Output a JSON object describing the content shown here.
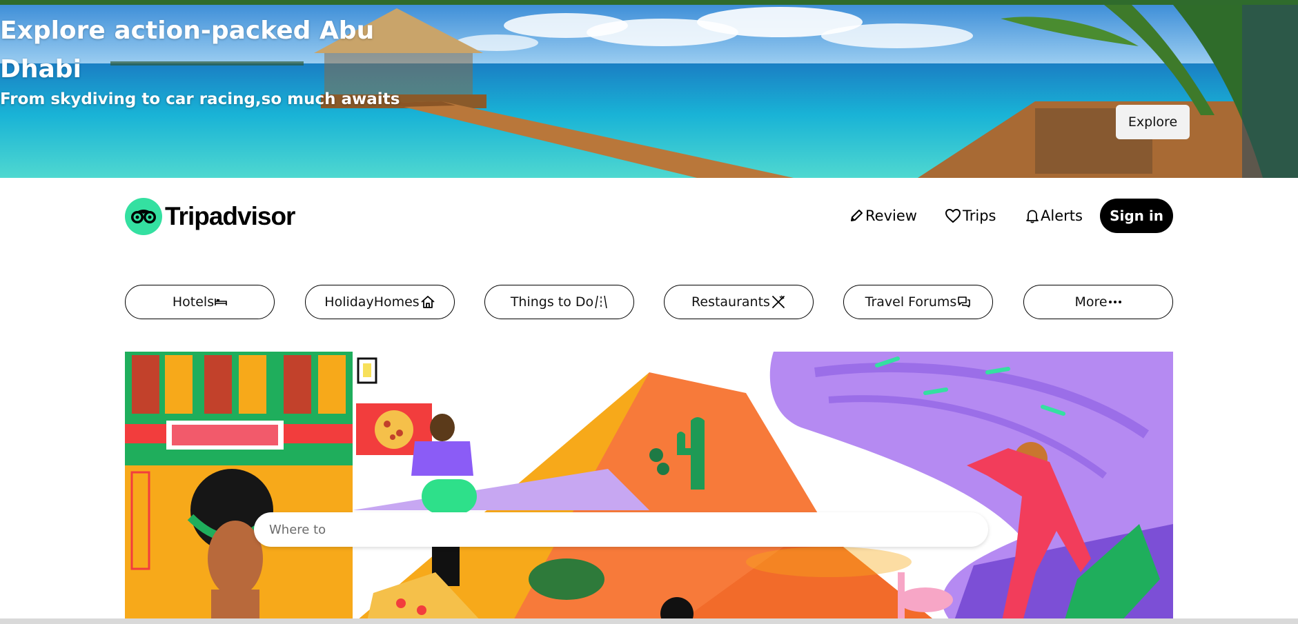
{
  "banner": {
    "title": "Explore action-packed Abu Dhabi",
    "subtitle": "From skydiving to car racing,so much awaits",
    "cta_label": "Explore"
  },
  "header": {
    "logo_text": "Tripadvisor",
    "nav": {
      "review": "Review",
      "trips": "Trips",
      "alerts": "Alerts"
    },
    "signin_label": "Sign in"
  },
  "categories": [
    {
      "label": "Hotels",
      "icon": "bed-icon"
    },
    {
      "label": "HolidayHomes",
      "icon": "home-icon"
    },
    {
      "label": "Things to Do",
      "icon": "road-icon"
    },
    {
      "label": "Restaurants",
      "icon": "utensils-icon"
    },
    {
      "label": "Travel Forums",
      "icon": "chat-icon"
    },
    {
      "label": "More",
      "icon": "ellipsis-icon"
    }
  ],
  "search": {
    "placeholder": "Where to"
  },
  "colors": {
    "brand_green": "#34e0a1",
    "signin_bg": "#000000",
    "top_strip": "#2f6b2c",
    "hero_purple": "#b58af2",
    "hero_orange": "#f7a91a"
  }
}
